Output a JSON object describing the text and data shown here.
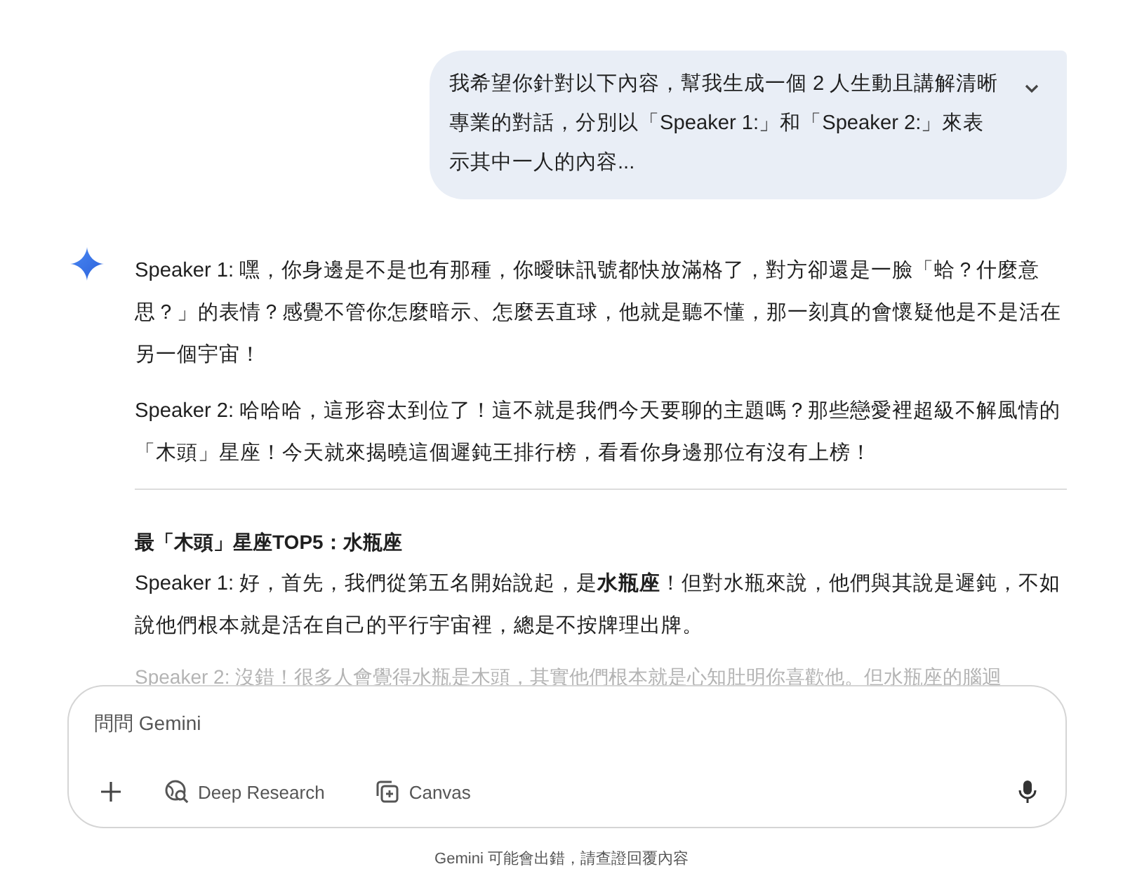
{
  "user_message": {
    "text": "我希望你針對以下內容，幫我生成一個 2 人生動且講解清晰專業的對話，分別以「Speaker 1:」和「Speaker 2:」來表示其中一人的內容...",
    "expanded": false
  },
  "response": {
    "blocks": [
      {
        "kind": "paragraph",
        "text": "Speaker 1: 嘿，你身邊是不是也有那種，你曖昧訊號都快放滿格了，對方卻還是一臉「蛤？什麼意思？」的表情？感覺不管你怎麼暗示、怎麼丟直球，他就是聽不懂，那一刻真的會懷疑他是不是活在另一個宇宙！"
      },
      {
        "kind": "paragraph",
        "text": "Speaker 2: 哈哈哈，這形容太到位了！這不就是我們今天要聊的主題嗎？那些戀愛裡超級不解風情的「木頭」星座！今天就來揭曉這個遲鈍王排行榜，看看你身邊那位有沒有上榜！"
      },
      {
        "kind": "divider"
      },
      {
        "kind": "heading",
        "text": "最「木頭」星座TOP5：水瓶座"
      },
      {
        "kind": "paragraph",
        "text": "Speaker 1: 好，首先，我們從第五名開始說起，是**水瓶座**！但對水瓶來說，他們與其說是遲鈍，不如說他們根本就是活在自己的平行宇宙裡，總是不按牌理出牌。"
      },
      {
        "kind": "faded",
        "text": "Speaker 2: 沒錯！很多人會覺得水瓶是木頭，其實他們根本就是心知肚明你喜歡他。但水瓶座的腦迴"
      }
    ]
  },
  "composer": {
    "placeholder": "問問 Gemini",
    "tools": [
      {
        "kind": "research",
        "label": "Deep Research"
      },
      {
        "kind": "canvas",
        "label": "Canvas"
      }
    ]
  },
  "disclaimer": "Gemini 可能會出錯，請查證回覆內容"
}
